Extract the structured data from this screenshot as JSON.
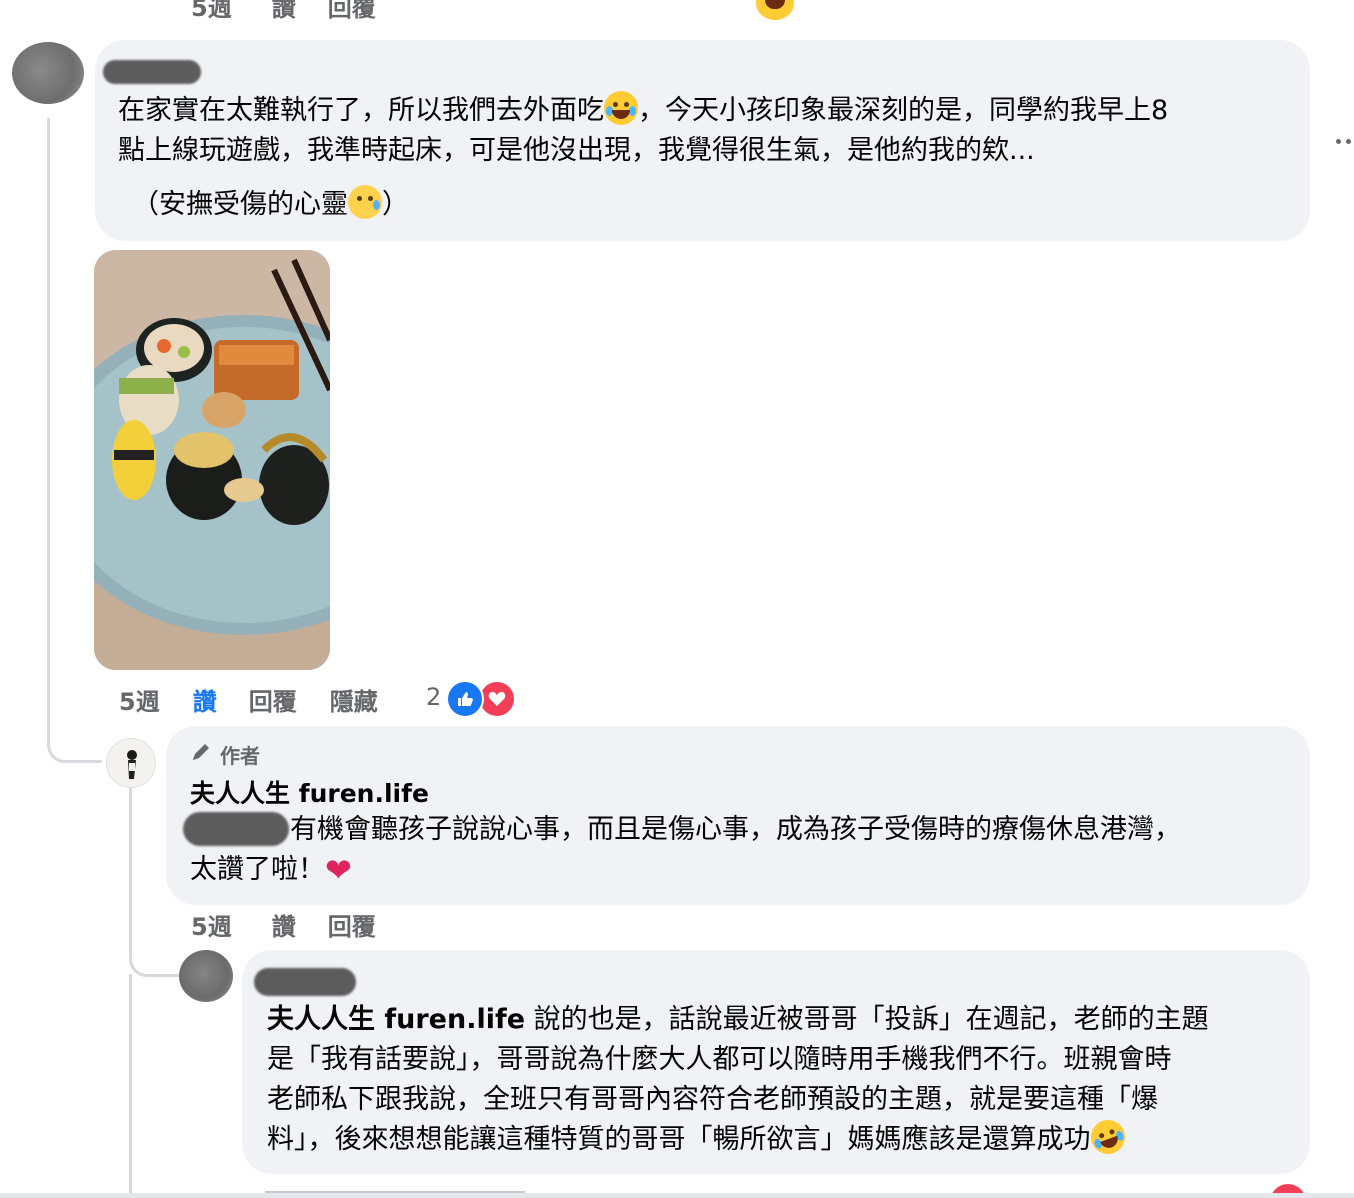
{
  "top_meta": {
    "time": "5週",
    "like": "讚",
    "reply": "回覆"
  },
  "comment1": {
    "text_line1a": "在家實在太難執行了，所以我們去外面吃",
    "text_line1b": "，今天小孩印象最深刻的是，同學約我早上8",
    "text_line2": "點上線玩遊戲，我準時起床，可是他沒出現，我覺得很生氣，是他約我的欸...",
    "text_line3a": "（安撫受傷的心靈",
    "text_line3b": "）",
    "emoji1": "laughing-crying-emoji",
    "emoji2": "crying-face-emoji",
    "photo_alt": "photo-of-sushi-plate",
    "time": "5週",
    "like": "讚",
    "reply": "回覆",
    "hide": "隱藏",
    "reaction_count": "2",
    "reactions": [
      "like-icon",
      "love-icon"
    ]
  },
  "reply1": {
    "badge": "作者",
    "author": "夫人人生 furen.life",
    "text_line1": "有機會聽孩子說說心事，而且是傷心事，成為孩子受傷時的療傷休息港灣，",
    "text_line2": "太讚了啦！",
    "heart": "❤",
    "time": "5週",
    "like": "讚",
    "reply": "回覆"
  },
  "reply2": {
    "mention": "夫人人生 furen.life",
    "text_line1": " 說的也是，話說最近被哥哥「投訴」在週記，老師的主題",
    "text_line2": "是「我有話要說」，哥哥說為什麼大人都可以隨時用手機我們不行。班親會時",
    "text_line3": "老師私下跟我說，全班只有哥哥內容符合老師預設的主題，就是要這種「爆",
    "text_line4": "料」，後來想想能讓這種特質的哥哥「暢所欲言」媽媽應該是還算成功",
    "emoji": "rolling-laughing-emoji"
  },
  "colors": {
    "bubble": "#f0f2f5",
    "meta": "#65676b",
    "like_active": "#1877f2",
    "love": "#f33e58"
  }
}
